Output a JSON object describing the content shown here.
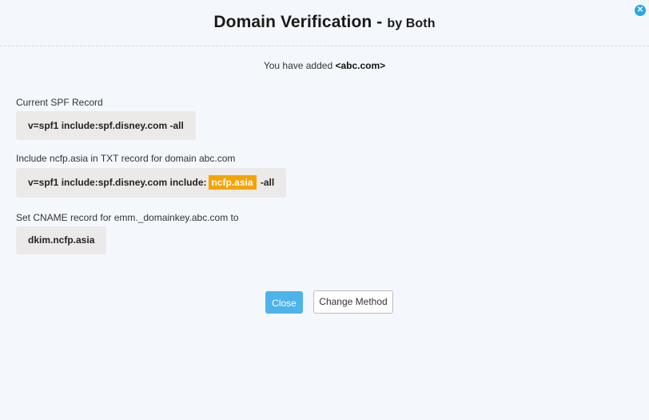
{
  "dialog": {
    "title": "Domain Verification -",
    "title_sub": "by Both",
    "close_icon": "✕"
  },
  "added": {
    "prefix": "You have added",
    "domain": "<abc.com>"
  },
  "spf": {
    "label": "Current SPF Record",
    "value": "v=spf1 include:spf.disney.com -all"
  },
  "txt": {
    "label": "Include ncfp.asia in TXT record for domain abc.com",
    "value_before": "v=spf1 include:spf.disney.com include:",
    "highlight": "ncfp.asia",
    "value_after": "-all"
  },
  "cname": {
    "label": "Set CNAME record for emm._domainkey.abc.com to",
    "value": "dkim.ncfp.asia"
  },
  "buttons": {
    "close": "Close",
    "change_method": "Change Method"
  },
  "colors": {
    "accent": "#4db3ea",
    "highlight": "#f5a300",
    "close_icon": "#2aa8e6"
  }
}
